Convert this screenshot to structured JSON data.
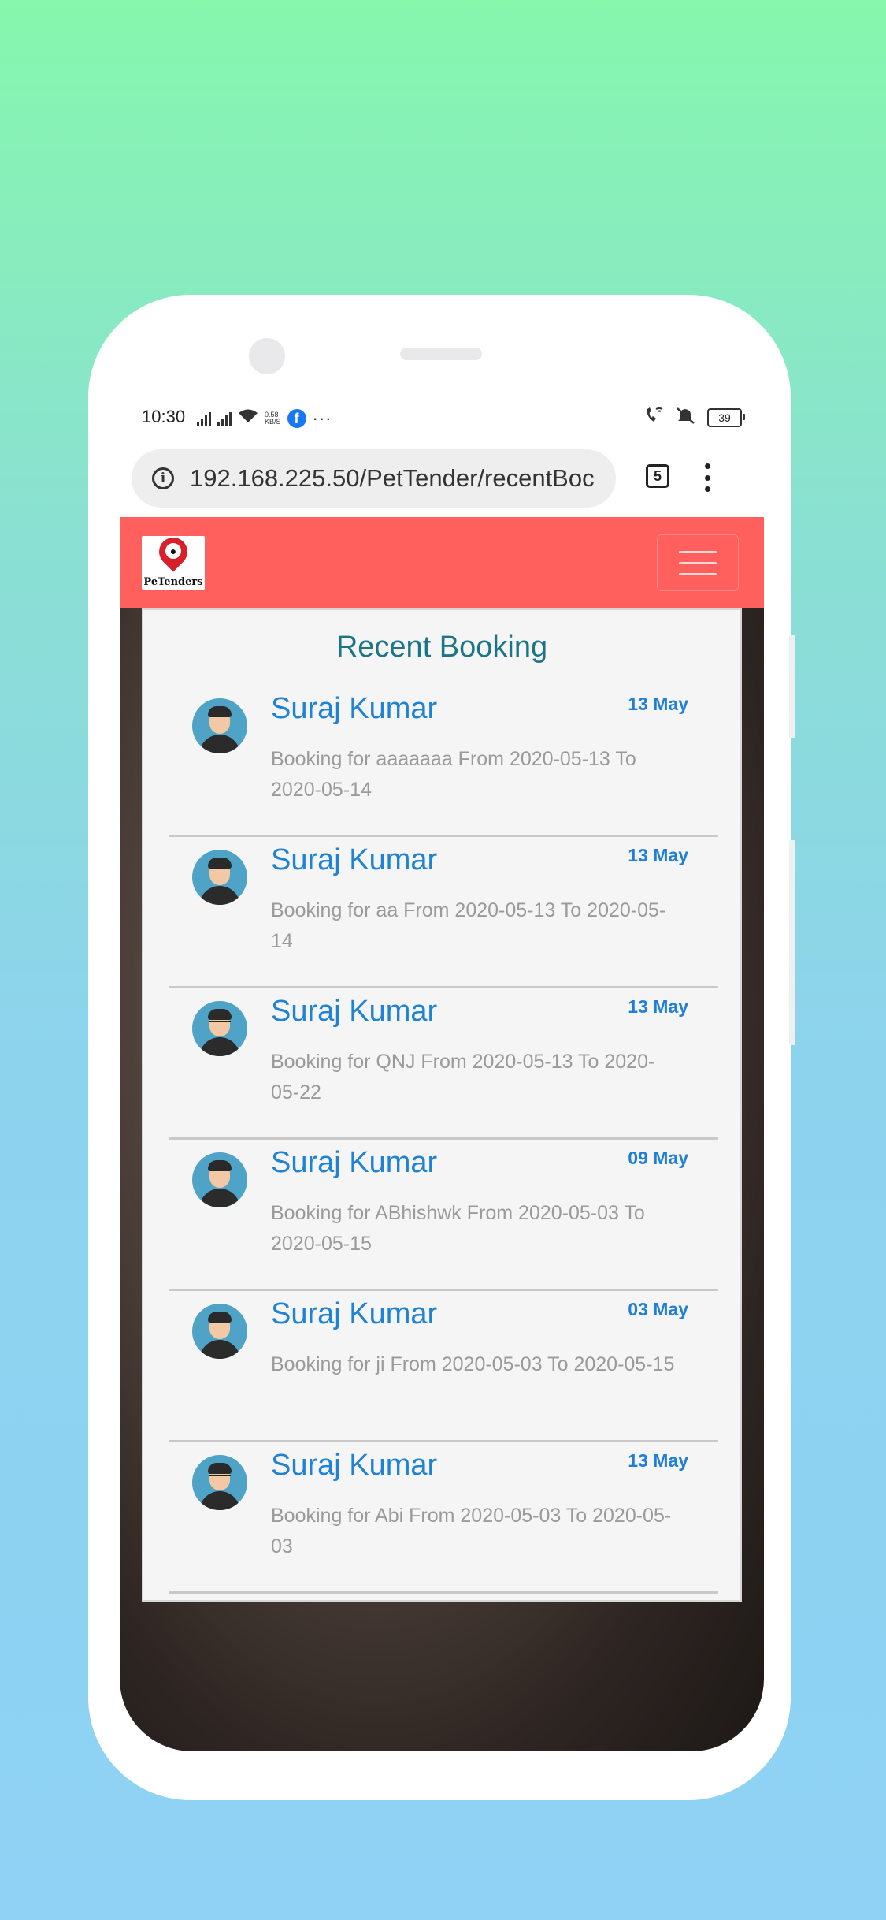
{
  "status_bar": {
    "time": "10:30",
    "data_speed_value": "0.58",
    "data_speed_unit": "KB/S",
    "more": "···",
    "battery": "39"
  },
  "browser": {
    "url": "192.168.225.50/PetTender/recentBoc",
    "tab_count": "5"
  },
  "navbar": {
    "logo_text": "PeTenders",
    "brand_color": "#ff5f5d"
  },
  "card": {
    "title": "Recent Booking"
  },
  "bookings": [
    {
      "name": "Suraj Kumar",
      "date": "13 May",
      "description": "Booking for aaaaaaa From 2020-05-13 To 2020-05-14",
      "avatar": "man-avatar"
    },
    {
      "name": "Suraj Kumar",
      "date": "13 May",
      "description": "Booking for aa From 2020-05-13 To 2020-05-14",
      "avatar": "man-avatar"
    },
    {
      "name": "Suraj Kumar",
      "date": "13 May",
      "description": "Booking for QNJ From 2020-05-13 To 2020-05-22",
      "avatar": "man-avatar-glasses"
    },
    {
      "name": "Suraj Kumar",
      "date": "09 May",
      "description": "Booking for ABhishwk From 2020-05-03 To 2020-05-15",
      "avatar": "man-avatar"
    },
    {
      "name": "Suraj Kumar",
      "date": "03 May",
      "description": "Booking for ji From 2020-05-03 To 2020-05-15",
      "avatar": "man-avatar"
    },
    {
      "name": "Suraj Kumar",
      "date": "13 May",
      "description": "Booking for Abi From 2020-05-03 To 2020-05-03",
      "avatar": "man-avatar-glasses"
    }
  ]
}
